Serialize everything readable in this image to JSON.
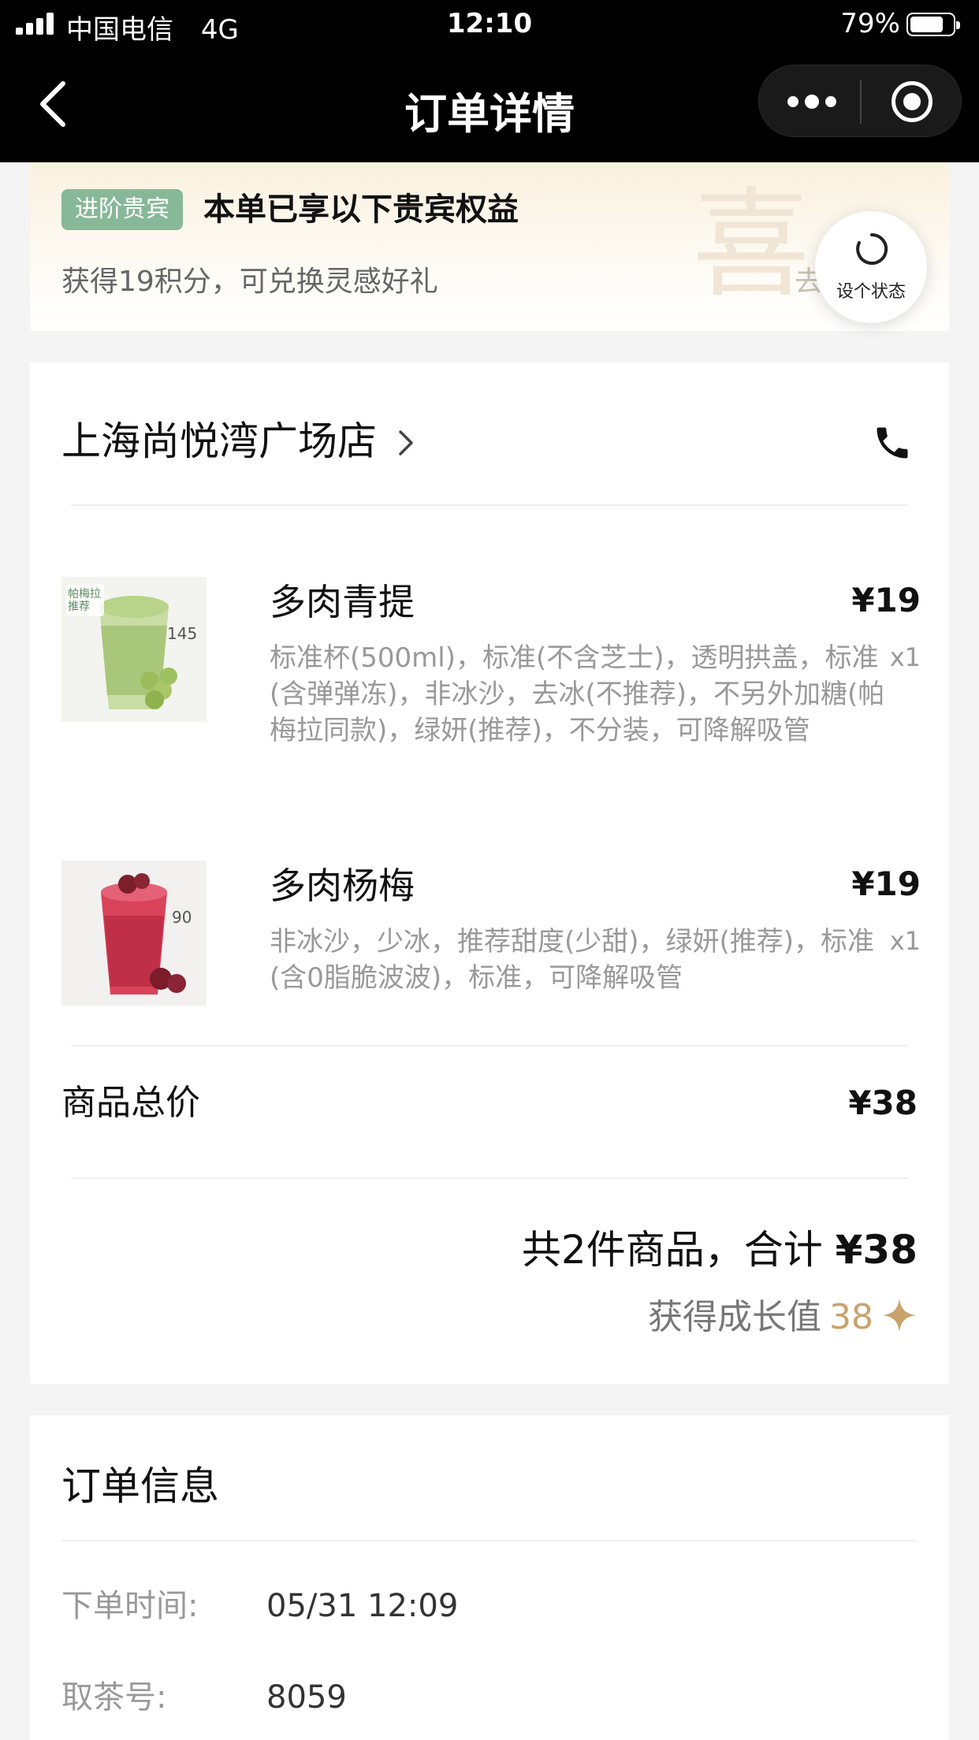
{
  "status_bar": {
    "carrier": "中国电信",
    "network": "4G",
    "time": "12:10",
    "battery": "79%",
    "battery_level": 0.79
  },
  "nav": {
    "title": "订单详情",
    "back_icon": "chevron-left-icon",
    "more_icon": "more-dots-icon",
    "close_icon": "target-circle-icon"
  },
  "vip": {
    "badge": "进阶贵宾",
    "title": "本单已享以下贵宾权益",
    "subtitle": "获得19积分，可兑换灵感好礼",
    "watermark": "喜",
    "link": "去",
    "badge_color": "#87b898"
  },
  "float_button": {
    "label": "设个状态",
    "icon": "refresh-ring-icon"
  },
  "store": {
    "name": "上海尚悦湾广场店",
    "phone_icon": "phone-icon"
  },
  "items": [
    {
      "name": "多肉青提",
      "price": "¥19",
      "qty": "x1",
      "desc": "标准杯(500ml)，标准(不含芝士)，透明拱盖，标准(含弹弹冻)，非冰沙，去冰(不推荐)，不另外加糖(帕梅拉同款)，绿妍(推荐)，不分装，可降解吸管",
      "image_tag": "帕梅拉推荐",
      "image_kcal": "145"
    },
    {
      "name": "多肉杨梅",
      "price": "¥19",
      "qty": "x1",
      "desc": "非冰沙，少冰，推荐甜度(少甜)，绿妍(推荐)，标准(含0脂脆波波)，标准，可降解吸管",
      "image_kcal": "90"
    }
  ],
  "summary": {
    "subtotal_label": "商品总价",
    "subtotal": "¥38",
    "total_text": "共2件商品，合计",
    "total_amount": "¥38",
    "growth_label": "获得成长值",
    "growth_value": "38",
    "accent_color": "#c9a26c"
  },
  "order_info": {
    "title": "订单信息",
    "rows": [
      {
        "key": "下单时间:",
        "value": "05/31 12:09"
      },
      {
        "key": "取茶号:",
        "value": "8059"
      }
    ]
  }
}
